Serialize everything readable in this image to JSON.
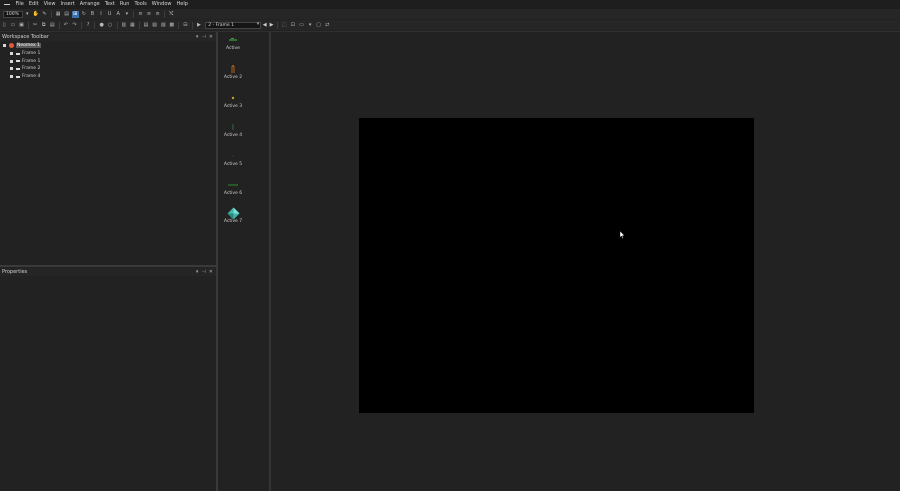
{
  "menu": [
    "File",
    "Edit",
    "View",
    "Insert",
    "Arrange",
    "Text",
    "Run",
    "Tools",
    "Window",
    "Help"
  ],
  "toolbar": {
    "zoom_value": "100%",
    "frame_select_value": "2 - Frame 1"
  },
  "workspace": {
    "title": "Workspace Toolbar",
    "root_label": "Neomex 1",
    "frames": [
      "Frame 1",
      "Frame 1",
      "Frame 2",
      "Frame 4"
    ]
  },
  "properties": {
    "title": "Properties"
  },
  "objects": [
    {
      "label": "Active",
      "icon": "active-sprite-icon",
      "color": "#3a8a3a"
    },
    {
      "label": "Active 2",
      "icon": "active-sprite-icon",
      "color": "#7a4a22"
    },
    {
      "label": "Active 3",
      "icon": "active-sprite-icon",
      "color": "#c8a020"
    },
    {
      "label": "Active 4",
      "icon": "active-sprite-icon",
      "color": "#2f6f3a"
    },
    {
      "label": "Active 5",
      "icon": "active-sprite-icon",
      "color": "#3a3a3a"
    },
    {
      "label": "Active 6",
      "icon": "active-sprite-icon",
      "color": "#2c8a2c"
    },
    {
      "label": "Active 7",
      "icon": "diamond-gem-icon",
      "color": "#3fb6a8"
    }
  ],
  "colors": {
    "background": "#222222",
    "frame": "#000000",
    "selection": "#5b5b5b",
    "accent": "#3a6fa8"
  }
}
